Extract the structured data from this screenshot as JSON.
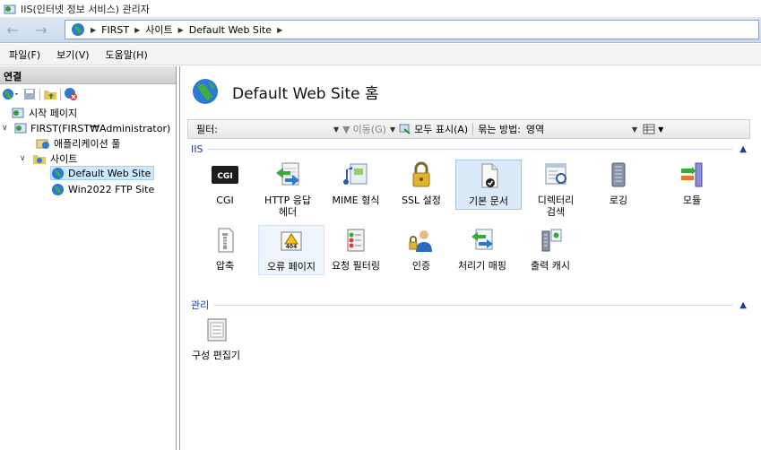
{
  "window": {
    "title": "IIS(인터넷 정보 서비스) 관리자"
  },
  "address": {
    "breadcrumbs": [
      "FIRST",
      "사이트",
      "Default Web Site"
    ]
  },
  "menu": {
    "items": [
      "파일(F)",
      "보기(V)",
      "도움말(H)"
    ]
  },
  "connections": {
    "header": "연결",
    "tree": {
      "start_page": "시작 페이지",
      "server": "FIRST(FIRST₩Administrator)",
      "app_pools": "애플리케이션 풀",
      "sites": "사이트",
      "site1": "Default Web Site",
      "site2": "Win2022 FTP Site"
    }
  },
  "main": {
    "title": "Default Web Site 홈",
    "filter": {
      "label": "필터:",
      "go_label": "이동(G)",
      "show_all_label": "모두 표시(A)",
      "group_by_label": "묶는 방법:",
      "group_by_value": "영역"
    },
    "groups": {
      "iis": "IIS",
      "management": "관리"
    },
    "features": {
      "cgi": "CGI",
      "http_resp_1": "HTTP 응답",
      "http_resp_2": "헤더",
      "mime": "MIME 형식",
      "ssl": "SSL 설정",
      "default_doc": "기본 문서",
      "dir_browse_1": "디렉터리",
      "dir_browse_2": "검색",
      "logging": "로깅",
      "modules": "모듈",
      "compression": "압축",
      "error_pages": "오류 페이지",
      "request_filtering": "요청 필터링",
      "authentication": "인증",
      "handler_mappings": "처리기 매핑",
      "output_caching": "출력 캐시",
      "config_editor": "구성 편집기"
    },
    "cgi_icon_text": "CGI",
    "error_icon_text": "404"
  },
  "colors": {
    "group_header": "#1c3d8f",
    "selection": "#dbeaf9"
  }
}
